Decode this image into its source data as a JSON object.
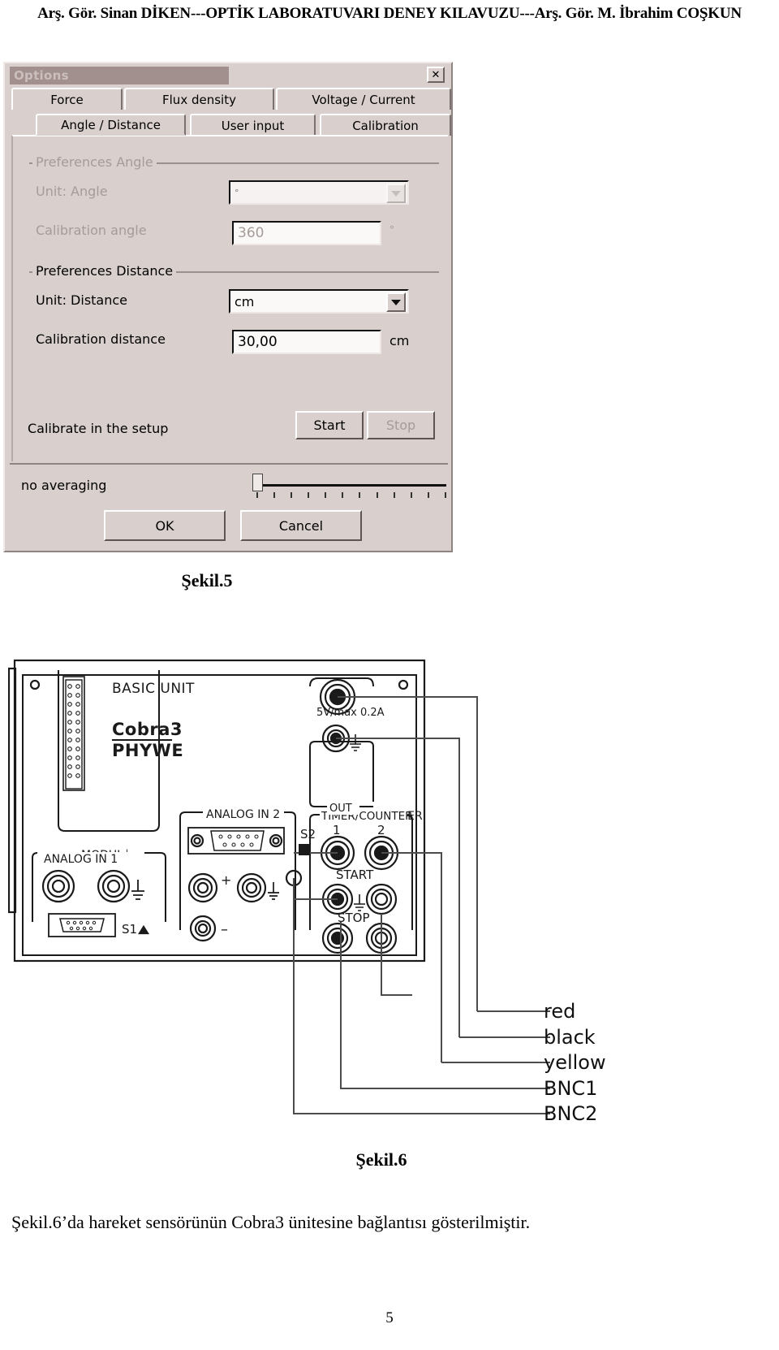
{
  "document": {
    "header": "Arş. Gör. Sinan DİKEN---OPTİK LABORATUVARI DENEY KILAVUZU---Arş. Gör. M. İbrahim COŞKUN",
    "page_number": "5",
    "body_paragraph": "Şekil.6’da hareket sensörünün Cobra3 ünitesine bağlantısı gösterilmiştir.",
    "figure5_caption": "Şekil.5",
    "figure6_caption": "Şekil.6"
  },
  "dialog": {
    "title": "Options",
    "close_label": "✕",
    "tabs_row1": [
      {
        "label": "Force"
      },
      {
        "label": "Flux density"
      },
      {
        "label": "Voltage / Current"
      }
    ],
    "tabs_row2": [
      {
        "label": "Angle / Distance"
      },
      {
        "label": "User input"
      },
      {
        "label": "Calibration"
      }
    ],
    "selected_tab": "Angle / Distance",
    "angle_group": {
      "title": "Preferences Angle",
      "unit_label": "Unit: Angle",
      "unit_value": "°",
      "calibration_label": "Calibration angle",
      "calibration_value": "360",
      "calibration_unit": "°",
      "enabled": "false"
    },
    "distance_group": {
      "title": "Preferences Distance",
      "unit_label": "Unit: Distance",
      "unit_value": "cm",
      "calibration_label": "Calibration distance",
      "calibration_value": "30,00",
      "calibration_unit": "cm",
      "enabled": "true"
    },
    "calibrate": {
      "label": "Calibrate in the setup",
      "start_label": "Start",
      "stop_label": "Stop"
    },
    "averaging": {
      "label": "no averaging",
      "slider_value": "0"
    },
    "ok_label": "OK",
    "cancel_label": "Cancel"
  },
  "figure6": {
    "device_title": "BASIC UNIT",
    "brand": "Cobra3",
    "brand_sub": "PHYWE",
    "out_power_rating": "5V/max 0.2A",
    "out_label": "OUT",
    "modul_label": "MODUL",
    "analog_in_1": "ANALOG IN 1",
    "analog_in_2": "ANALOG IN 2",
    "switch_s1": "S1",
    "switch_s2": "S2",
    "timer_counter": "TIMER/COUNTER",
    "timer_1": "1",
    "timer_2": "2",
    "start_label": "START",
    "stop_label": "STOP",
    "plus_sign": "+",
    "minus_sign": "–",
    "wire_labels": [
      {
        "name": "red"
      },
      {
        "name": "black"
      },
      {
        "name": "yellow"
      },
      {
        "name": "BNC1"
      },
      {
        "name": "BNC2"
      }
    ]
  }
}
